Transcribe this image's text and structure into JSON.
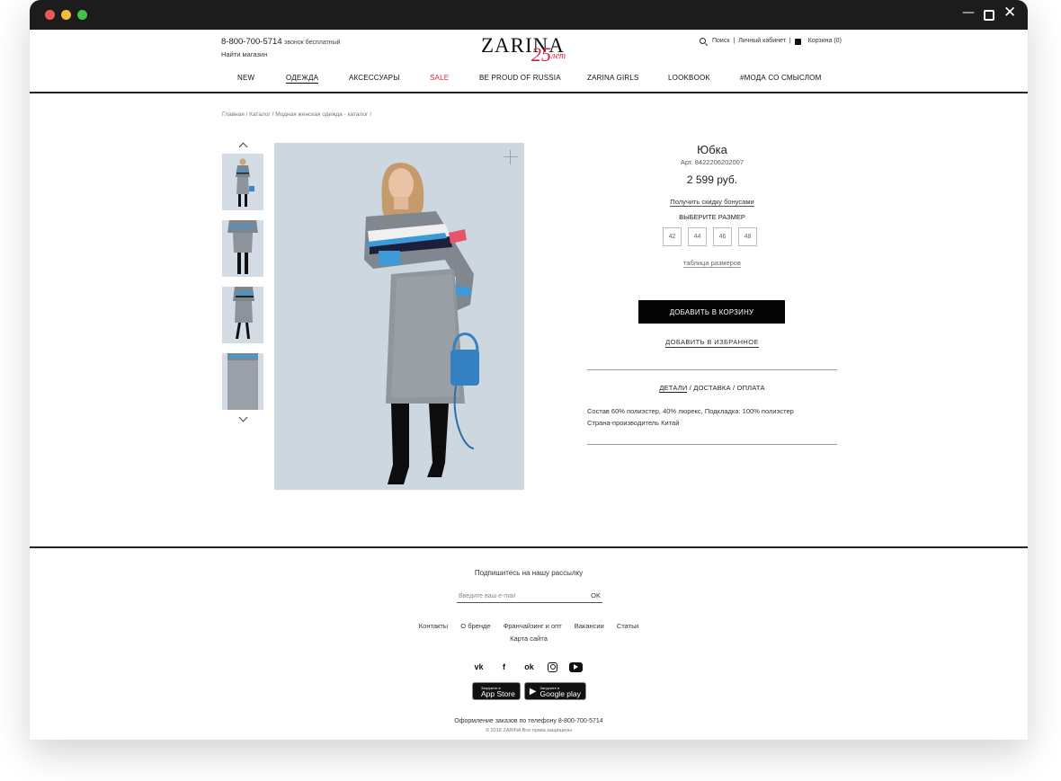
{
  "header": {
    "phone": "8-800-700-5714",
    "phone_note": "звонок бесплатный",
    "find_store": "Найти магазин",
    "logo": "ZARINA",
    "logo_25": "25",
    "logo_let": "лет",
    "search": "Поиск",
    "account": "Личный кабинет",
    "cart": "Корзина (0)"
  },
  "nav": [
    "NEW",
    "ОДЕЖДА",
    "АКСЕССУАРЫ",
    "SALE",
    "BE PROUD OF RUSSIA",
    "ZARINA GIRLS",
    "LOOKBOOK",
    "#МОДА СО СМЫСЛОМ"
  ],
  "breadcrumb": "Главная  /  Каталог  /  Модная женская одежда - каталог  /",
  "product": {
    "title": "Юбка",
    "article": "Арт. 8422206202007",
    "price": "2 599 руб.",
    "bonus_link": "Получить скидку бонусами",
    "size_label": "ВЫБЕРИТЕ РАЗМЕР",
    "sizes": [
      "42",
      "44",
      "46",
      "48"
    ],
    "size_table": "таблица размеров",
    "add_to_cart": "ДОБАВИТЬ В КОРЗИНУ",
    "add_to_fav": "ДОБАВИТЬ В ИЗБРАННОЕ",
    "tab_details": "ДЕТАЛИ",
    "tab_delivery": "ДОСТАВКА",
    "tab_payment": "ОПЛАТА",
    "composition": "Состав 60% полиэстер, 40% люрекс, Подкладка: 100% полиэстер",
    "country": "Страна-производитель Китай"
  },
  "footer": {
    "subscribe": "Подпишитесь на нашу рассылку",
    "email_placeholder": "Введите ваш e-mail",
    "ok": "OK",
    "links": [
      "Контакты",
      "О бренде",
      "Франчайзинг и опт",
      "Вакансии",
      "Статьи"
    ],
    "sitemap": "Карта сайта",
    "appstore_small": "Загрузите в",
    "appstore_big": "App Store",
    "googleplay_small": "Загрузите в",
    "googleplay_big": "Google play",
    "order_phone": "Оформление заказов по телефону 8-800-700-5714",
    "copyright": "© 2018 ZARINA Все права защищены"
  },
  "colors": {
    "accent_red": "#d81f3b",
    "button_black": "#050505"
  }
}
